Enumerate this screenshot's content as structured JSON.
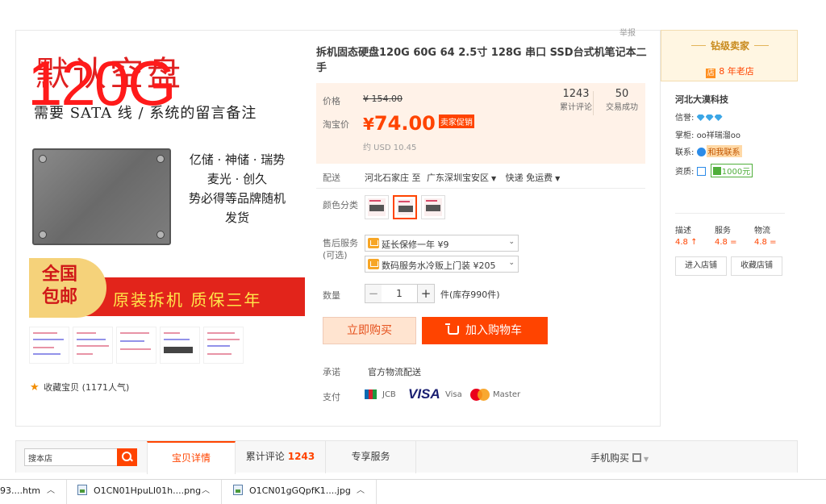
{
  "report_link": "举报",
  "gallery": {
    "headline": "默认空盘",
    "subline": "需要 SATA 线 / 系统的留言备注",
    "capacity": "120G",
    "brand_lines": [
      "亿储 · 神储 · 瑞势",
      "麦光 · 创久",
      "势必得等品牌随机",
      "发货"
    ],
    "promo_badge": "全国包邮",
    "promo_text": "原装拆机  质保三年",
    "thumb_count": 5,
    "favorite_label": "收藏宝贝",
    "favorite_count": "(1171人气)"
  },
  "product": {
    "title": "拆机固态硬盘120G 60G 64 2.5寸 128G 串口 SSD台式机笔记本二手",
    "price_label": "价格",
    "old_price": "¥ 154.00",
    "taobao_price_label": "淘宝价",
    "currency": "¥",
    "price": "74.00",
    "promo_tag": "卖家促销",
    "usd_price": "约 USD 10.45",
    "reviews_count": "1243",
    "reviews_label": "累计评论",
    "sales_count": "50",
    "sales_label": "交易成功",
    "shipping_label": "配送",
    "ship_from": "河北石家庄 至",
    "ship_to": "广东深圳宝安区",
    "ship_method": "快递 免运费",
    "color_label": "颜色分类",
    "after_sales_label": "售后服务",
    "after_sales_optional": "(可选)",
    "warranty_option": "延长保修一年 ¥9",
    "repair_option": "数码服务水冷贩上门装 ¥205",
    "qty_label": "数量",
    "qty_value": "1",
    "stock_text": "件(库存990件)",
    "buy_now": "立即购买",
    "add_cart": "加入购物车",
    "promise_label": "承诺",
    "promise_value": "官方物流配送",
    "pay_label": "支付",
    "pay_jcb": "JCB",
    "pay_visa_logo": "VISA",
    "pay_visa": "Visa",
    "pay_master": "Master"
  },
  "shop": {
    "level": "钻级卖家",
    "store_icon": "店",
    "years": "8 年老店",
    "name": "河北大漠科技",
    "credit_label": "信誉:",
    "owner_label": "掌柜:",
    "owner": "oo祥瑞溜oo",
    "contact_label": "联系:",
    "contact_btn": "和我联系",
    "deposit_label": "资质:",
    "deposit": "1000元",
    "scores": [
      {
        "label": "描述",
        "value": "4.8 ↑"
      },
      {
        "label": "服务",
        "value": "4.8 ="
      },
      {
        "label": "物流",
        "value": "4.8 ="
      }
    ],
    "enter_btn": "进入店铺",
    "fav_btn": "收藏店铺"
  },
  "tabs": {
    "search_value": "搜本店",
    "details": "宝贝详情",
    "reviews": "累计评论",
    "reviews_count": "1243",
    "services": "专享服务",
    "mobile_buy": "手机购买"
  },
  "downloads": [
    {
      "name": "93....htm"
    },
    {
      "name": "O1CN01HpuLI01h....png"
    },
    {
      "name": "O1CN01gGQpfK1....jpg"
    }
  ],
  "colors": {
    "accent": "#ff4400",
    "price_panel_bg": "#fff2e8",
    "seller_gold": "#c88a1c"
  }
}
